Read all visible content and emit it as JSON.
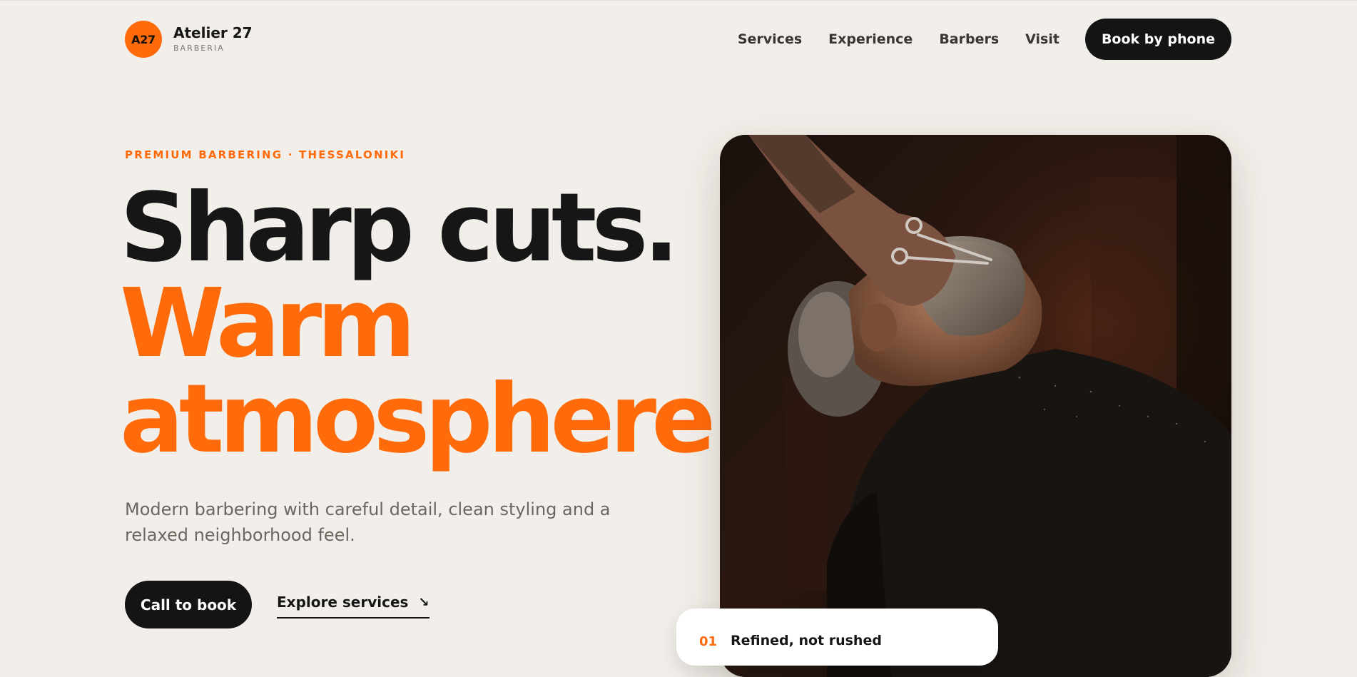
{
  "brand": {
    "badge": "A27",
    "name": "Atelier 27",
    "sub": "BARBERIA",
    "accent": "#ff6a0a"
  },
  "nav": {
    "links": [
      "Services",
      "Experience",
      "Barbers",
      "Visit"
    ],
    "cta": "Book by phone"
  },
  "hero": {
    "eyebrow": "PREMIUM BARBERING · THESSALONIKI",
    "line1": "Sharp cuts.",
    "line2": "Warm",
    "line3": "atmosphere.",
    "description": "Modern barbering with careful detail, clean styling and a relaxed neighborhood feel.",
    "primary_cta": "Call to book",
    "secondary_cta": "Explore services",
    "secondary_icon": "arrow-down-right-icon"
  },
  "card": {
    "number": "01",
    "title": "Refined, not rushed"
  },
  "colors": {
    "background": "#f2eee9",
    "dark": "#141414",
    "accent": "#ff6a0a"
  }
}
